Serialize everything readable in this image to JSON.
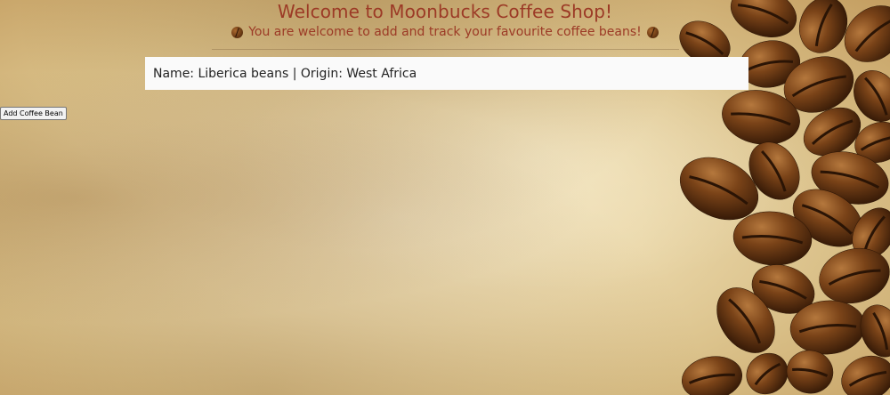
{
  "header": {
    "title": "Welcome to Moonbucks Coffee Shop!",
    "subtitle": "You are welcome to add and track your favourite coffee beans!"
  },
  "beans": [
    {
      "display": "Name: Liberica beans | Origin: West Africa"
    }
  ],
  "actions": {
    "add_bean_label": "Add Coffee Bean"
  },
  "colors": {
    "title": "#9c3a26",
    "card_bg": "#fafafa",
    "bean_dark": "#3e1f08",
    "bean_mid": "#6b3a14"
  },
  "icons": {
    "subtitle_left": "coffee-bean-icon",
    "subtitle_right": "coffee-bean-icon"
  },
  "background": {
    "description_free": "parchment",
    "decoration": "coffee-beans-pile"
  }
}
